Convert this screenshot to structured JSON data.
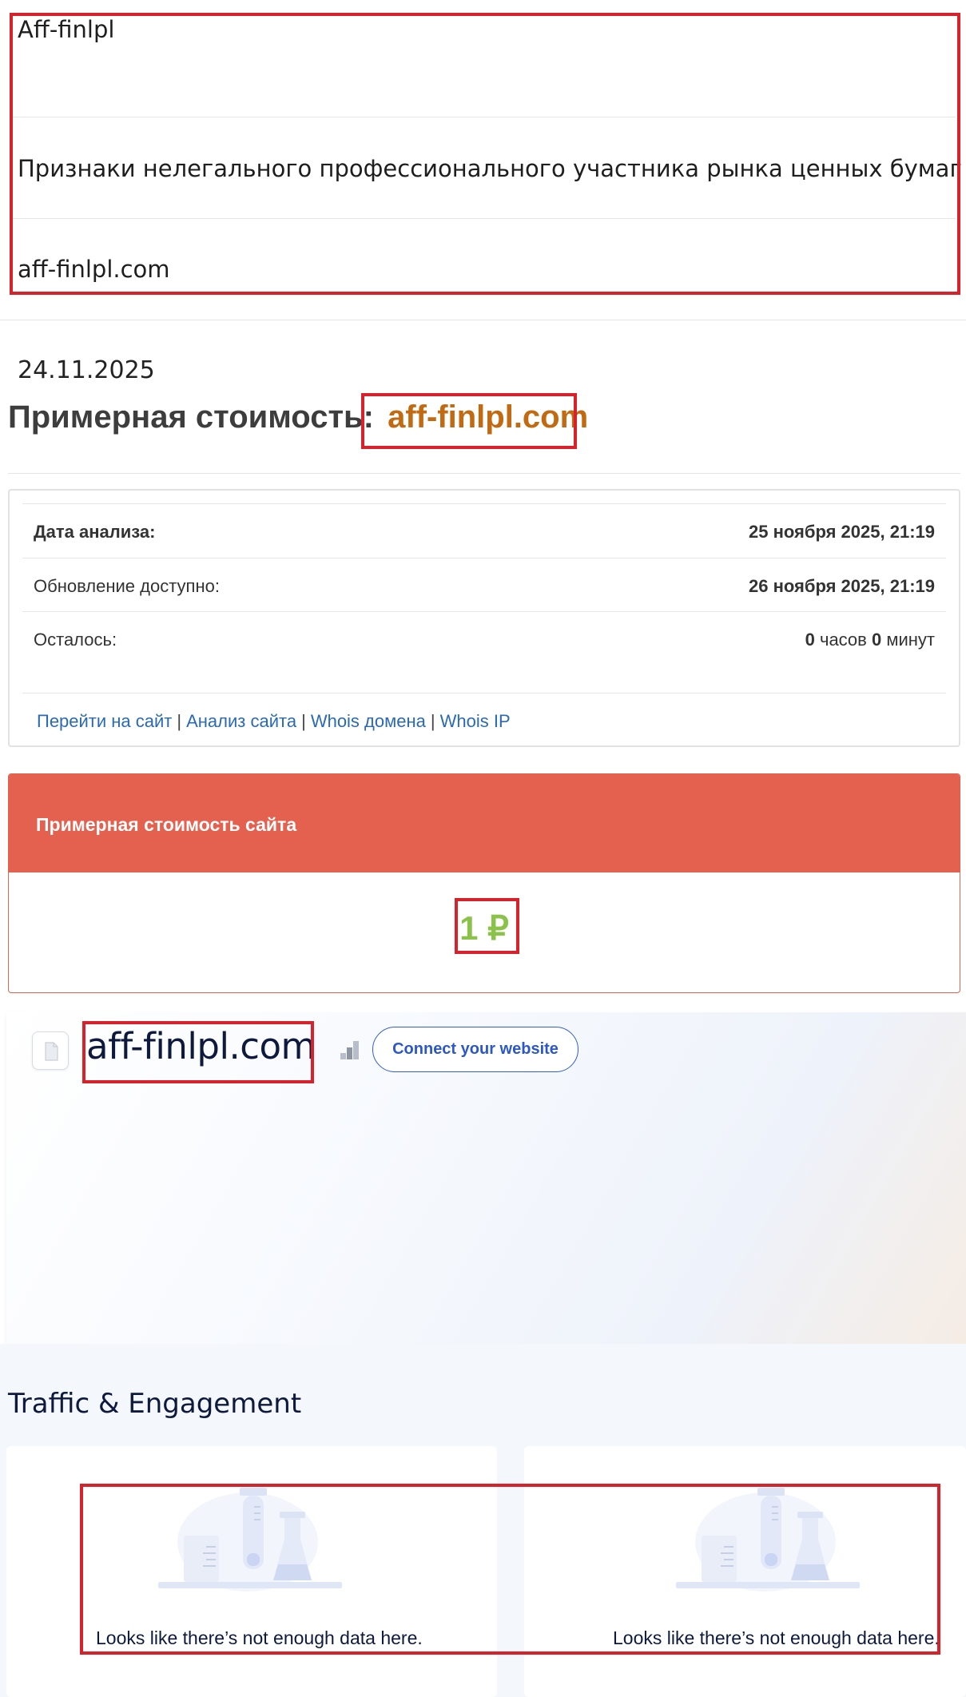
{
  "listing": {
    "name": "Aff-finlpl",
    "category": "Признаки нелегального профессионального участника рынка ценных бумаг",
    "domain": "aff-finlpl.com"
  },
  "price_section": {
    "date": "24.11.2025",
    "heading_prefix": "Примерная стоимость:",
    "heading_domain": "aff-finlpl.com",
    "rows": [
      {
        "label": "Дата анализа:",
        "value": "25 ноября 2025, 21:19"
      },
      {
        "label": "Обновление доступно:",
        "value": "26 ноября 2025, 21:19"
      },
      {
        "label": "Осталось:",
        "hours": "0",
        "hours_unit": "часов",
        "minutes": "0",
        "minutes_unit": "минут"
      }
    ],
    "links": [
      "Перейти на сайт",
      "Анализ сайта",
      "Whois домена",
      "Whois IP"
    ],
    "links_separator": "|",
    "cost_title": "Примерная стоимость сайта",
    "cost_value": "1 ₽"
  },
  "similarweb": {
    "domain": "aff-finlpl.com",
    "connect_button": "Connect your website",
    "section_title": "Traffic & Engagement",
    "empty_message_left": "Looks like there’s not enough data here.",
    "empty_message_right": "Looks like there’s not enough data here."
  },
  "icons": [
    "file-icon",
    "rank-bars-icon",
    "lab-flasks-icon"
  ],
  "colors": {
    "highlight_red": "#d7222c",
    "domain_orange": "#c26a11",
    "cost_header": "#e4604f",
    "cost_value_green": "#8bc34a",
    "link_blue": "#2a6ab3",
    "sw_navy": "#0d1a3d",
    "sw_button_blue": "#2f5ed6"
  }
}
